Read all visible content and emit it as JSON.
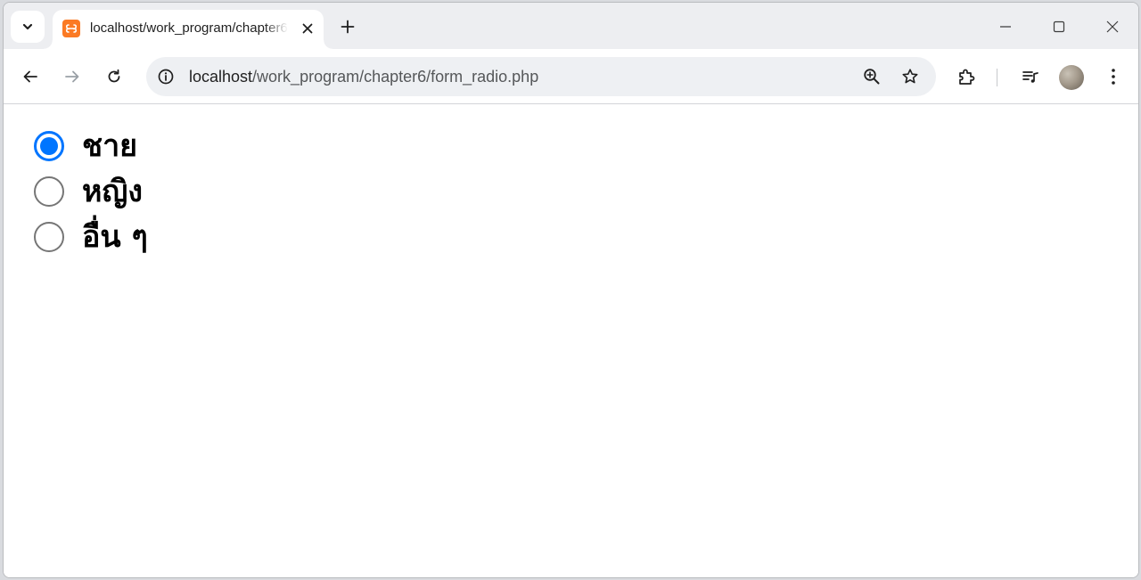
{
  "browser": {
    "tab": {
      "title": "localhost/work_program/chapter6/form_radio.php",
      "favicon": "xampp-icon"
    },
    "address_bar": {
      "host": "localhost",
      "path": "/work_program/chapter6/form_radio.php"
    },
    "icons": {
      "tab_search": "chevron-down-icon",
      "tab_close": "close-icon",
      "new_tab": "plus-icon",
      "minimize": "minimize-icon",
      "maximize": "maximize-icon",
      "close_window": "close-icon",
      "back": "back-arrow-icon",
      "forward": "forward-arrow-icon",
      "reload": "reload-icon",
      "site_info": "info-icon",
      "zoom": "zoom-in-icon",
      "bookmark": "star-icon",
      "extensions": "puzzle-icon",
      "media": "media-controls-icon",
      "menu": "kebab-menu-icon"
    }
  },
  "form": {
    "radio_options": [
      {
        "label": "ชาย",
        "checked": true
      },
      {
        "label": "หญิง",
        "checked": false
      },
      {
        "label": "อื่น ๆ",
        "checked": false
      }
    ]
  },
  "colors": {
    "radio_accent": "#0075ff",
    "favicon": "#fb7a24",
    "omnibox_bg": "#eef0f3",
    "tabstrip_bg": "#edeef1"
  }
}
